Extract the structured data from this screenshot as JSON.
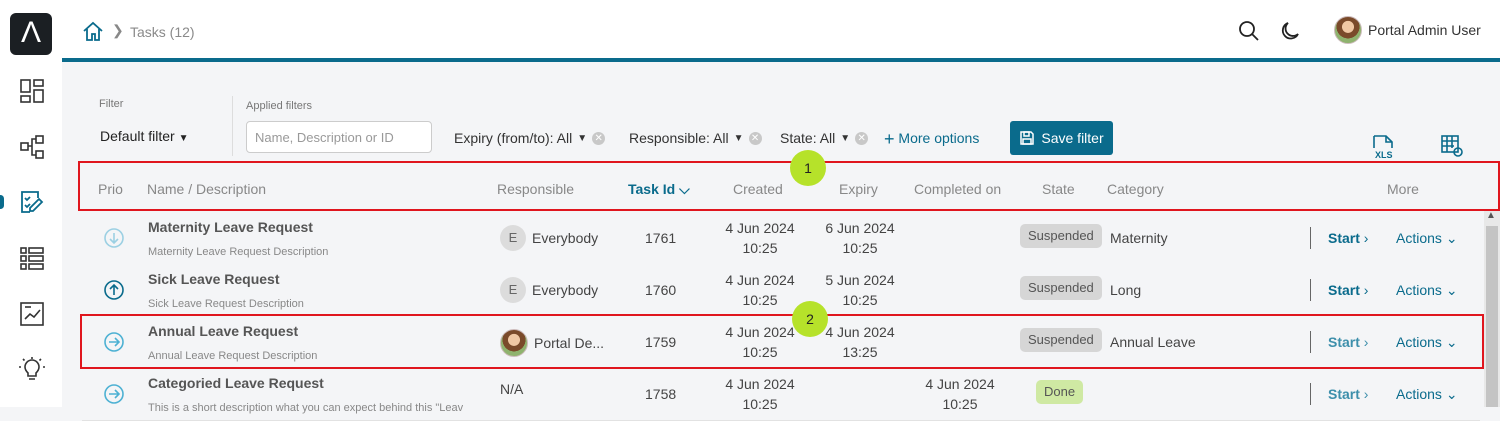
{
  "nav": {
    "logo_glyph": "Λ",
    "icons": [
      "dashboard-icon",
      "process-icon",
      "tasks-icon",
      "list-icon",
      "report-icon",
      "lightbulb-icon"
    ]
  },
  "breadcrumb": {
    "label": "Tasks (12)"
  },
  "user": {
    "name": "Portal Admin User"
  },
  "filter": {
    "label": "Filter",
    "value": "Default filter",
    "applied_label": "Applied filters",
    "search_placeholder": "Name, Description or ID"
  },
  "chips": {
    "expiry": "Expiry (from/to): All",
    "responsible": "Responsible: All",
    "state": "State: All"
  },
  "more_options": "More options",
  "save_filter": "Save filter",
  "xls_label": "XLS",
  "columns": {
    "prio": "Prio",
    "name": "Name / Description",
    "responsible": "Responsible",
    "task_id": "Task Id",
    "created": "Created",
    "expiry": "Expiry",
    "completed": "Completed on",
    "state": "State",
    "category": "Category",
    "more": "More"
  },
  "markers": {
    "one": "1",
    "two": "2"
  },
  "rows": [
    {
      "prio": "low",
      "title": "Maternity Leave Request",
      "desc": "Maternity Leave Request Description",
      "resp_initial": "E",
      "responsible": "Everybody",
      "id": "1761",
      "created_d": "4 Jun 2024",
      "created_t": "10:25",
      "expiry_d": "6 Jun 2024",
      "expiry_t": "10:25",
      "completed_d": "",
      "completed_t": "",
      "state": "Suspended",
      "category": "Maternity",
      "start": "Start",
      "actions": "Actions"
    },
    {
      "prio": "high",
      "title": "Sick Leave Request",
      "desc": "Sick Leave Request Description",
      "resp_initial": "E",
      "responsible": "Everybody",
      "id": "1760",
      "created_d": "4 Jun 2024",
      "created_t": "10:25",
      "expiry_d": "5 Jun 2024",
      "expiry_t": "10:25",
      "completed_d": "",
      "completed_t": "",
      "state": "Suspended",
      "category": "Long",
      "start": "Start",
      "actions": "Actions"
    },
    {
      "prio": "normal",
      "title": "Annual Leave Request",
      "desc": "Annual Leave Request Description",
      "resp_initial": "",
      "responsible": "Portal De...",
      "id": "1759",
      "created_d": "4 Jun 2024",
      "created_t": "10:25",
      "expiry_d": "4 Jun 2024",
      "expiry_t": "13:25",
      "completed_d": "",
      "completed_t": "",
      "state": "Suspended",
      "category": "Annual Leave",
      "start": "Start",
      "actions": "Actions"
    },
    {
      "prio": "normal",
      "title": "Categoried Leave Request",
      "desc": "This is a short description what you can expect behind this \"Leav",
      "resp_initial": "",
      "responsible": "N/A",
      "id": "1758",
      "created_d": "4 Jun 2024",
      "created_t": "10:25",
      "expiry_d": "",
      "expiry_t": "",
      "completed_d": "4 Jun 2024",
      "completed_t": "10:25",
      "state": "Done",
      "category": "",
      "start": "Start",
      "actions": "Actions"
    }
  ]
}
